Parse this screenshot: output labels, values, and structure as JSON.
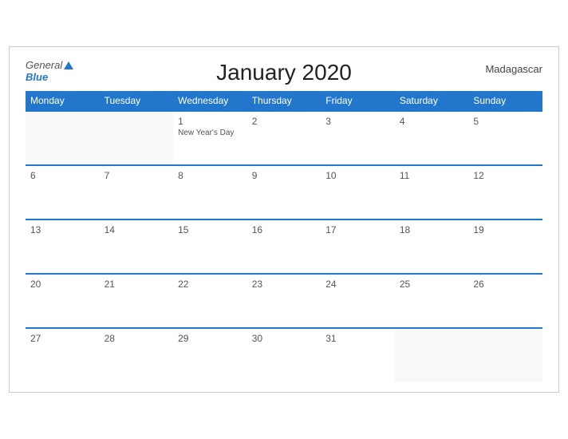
{
  "header": {
    "title": "January 2020",
    "country": "Madagascar",
    "logo_general": "General",
    "logo_blue": "Blue"
  },
  "weekdays": [
    "Monday",
    "Tuesday",
    "Wednesday",
    "Thursday",
    "Friday",
    "Saturday",
    "Sunday"
  ],
  "weeks": [
    [
      {
        "num": "",
        "event": ""
      },
      {
        "num": "",
        "event": ""
      },
      {
        "num": "1",
        "event": "New Year's Day"
      },
      {
        "num": "2",
        "event": ""
      },
      {
        "num": "3",
        "event": ""
      },
      {
        "num": "4",
        "event": ""
      },
      {
        "num": "5",
        "event": ""
      }
    ],
    [
      {
        "num": "6",
        "event": ""
      },
      {
        "num": "7",
        "event": ""
      },
      {
        "num": "8",
        "event": ""
      },
      {
        "num": "9",
        "event": ""
      },
      {
        "num": "10",
        "event": ""
      },
      {
        "num": "11",
        "event": ""
      },
      {
        "num": "12",
        "event": ""
      }
    ],
    [
      {
        "num": "13",
        "event": ""
      },
      {
        "num": "14",
        "event": ""
      },
      {
        "num": "15",
        "event": ""
      },
      {
        "num": "16",
        "event": ""
      },
      {
        "num": "17",
        "event": ""
      },
      {
        "num": "18",
        "event": ""
      },
      {
        "num": "19",
        "event": ""
      }
    ],
    [
      {
        "num": "20",
        "event": ""
      },
      {
        "num": "21",
        "event": ""
      },
      {
        "num": "22",
        "event": ""
      },
      {
        "num": "23",
        "event": ""
      },
      {
        "num": "24",
        "event": ""
      },
      {
        "num": "25",
        "event": ""
      },
      {
        "num": "26",
        "event": ""
      }
    ],
    [
      {
        "num": "27",
        "event": ""
      },
      {
        "num": "28",
        "event": ""
      },
      {
        "num": "29",
        "event": ""
      },
      {
        "num": "30",
        "event": ""
      },
      {
        "num": "31",
        "event": ""
      },
      {
        "num": "",
        "event": ""
      },
      {
        "num": "",
        "event": ""
      }
    ]
  ]
}
